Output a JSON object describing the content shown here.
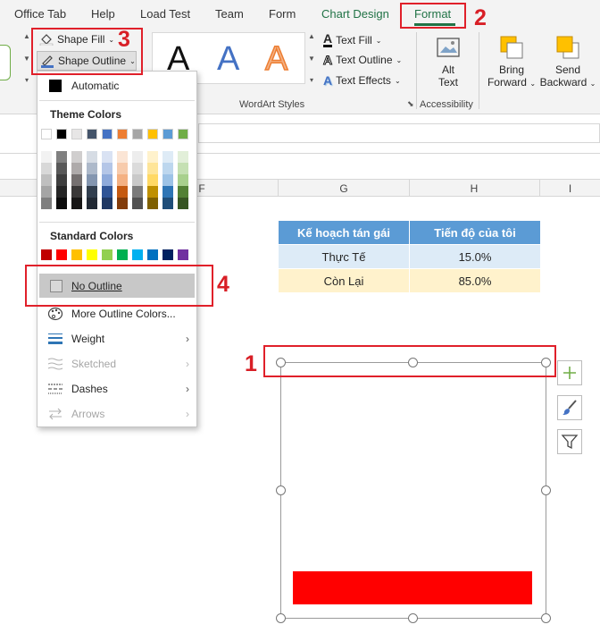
{
  "ribbon": {
    "tabs": [
      {
        "label": "Office Tab"
      },
      {
        "label": "Help"
      },
      {
        "label": "Load Test"
      },
      {
        "label": "Team"
      },
      {
        "label": "Form"
      },
      {
        "label": "Chart Design"
      },
      {
        "label": "Format"
      }
    ],
    "shape_fill": "Shape Fill",
    "shape_outline": "Shape Outline",
    "text_fill": "Text Fill",
    "text_outline": "Text Outline",
    "text_effects": "Text Effects",
    "wordart_group": "WordArt Styles",
    "wordart_letter": "A",
    "alt_text_line1": "Alt",
    "alt_text_line2": "Text",
    "accessibility_group": "Accessibility",
    "bring_forward_line1": "Bring",
    "bring_forward_line2": "Forward",
    "send_backward_line1": "Send",
    "send_backward_line2": "Backward"
  },
  "columns": [
    "F",
    "G",
    "H",
    "I"
  ],
  "table": {
    "headers": [
      "Kế hoạch tán gái",
      "Tiến độ của tôi"
    ],
    "rows": [
      [
        "Thực Tế",
        "15.0%"
      ],
      [
        "Còn Lại",
        "85.0%"
      ]
    ]
  },
  "outline_menu": {
    "automatic": "Automatic",
    "theme_colors_title": "Theme Colors",
    "standard_colors_title": "Standard Colors",
    "no_outline": "No Outline",
    "more_colors": "More Outline Colors...",
    "weight": "Weight",
    "sketched": "Sketched",
    "dashes": "Dashes",
    "arrows": "Arrows"
  },
  "theme_colors": [
    "#ffffff",
    "#000000",
    "#e7e6e6",
    "#44546a",
    "#4472c4",
    "#ed7d31",
    "#a5a5a5",
    "#ffc000",
    "#5b9bd5",
    "#70ad47"
  ],
  "theme_tints": [
    [
      "#f2f2f2",
      "#808080",
      "#d0cece",
      "#d6dce4",
      "#d9e2f3",
      "#fbe5d5",
      "#ededed",
      "#fff2cc",
      "#deebf6",
      "#e2efd9"
    ],
    [
      "#d8d8d8",
      "#595959",
      "#aeaaaa",
      "#adb9ca",
      "#b4c6e7",
      "#f7cbac",
      "#dbdbdb",
      "#fee599",
      "#bdd7ee",
      "#c5e0b3"
    ],
    [
      "#bfbfbf",
      "#3f3f3f",
      "#757070",
      "#8496b0",
      "#8eaadb",
      "#f4b183",
      "#c9c9c9",
      "#ffd965",
      "#9dc3e6",
      "#a8d08d"
    ],
    [
      "#a5a5a5",
      "#262626",
      "#3a3838",
      "#323f4f",
      "#2f5496",
      "#c55a11",
      "#7b7b7b",
      "#bf9000",
      "#2e75b5",
      "#538135"
    ],
    [
      "#7f7f7f",
      "#0c0c0c",
      "#171616",
      "#222a35",
      "#1f3864",
      "#833c0b",
      "#525252",
      "#7f6000",
      "#1f4e79",
      "#375623"
    ]
  ],
  "standard_colors": [
    "#c00000",
    "#ff0000",
    "#ffc000",
    "#ffff00",
    "#92d050",
    "#00b050",
    "#00b0f0",
    "#0070c0",
    "#002060",
    "#7030a0"
  ],
  "chart": {
    "bar_color": "#ff0000"
  },
  "annotations": [
    "1",
    "2",
    "3",
    "4"
  ]
}
